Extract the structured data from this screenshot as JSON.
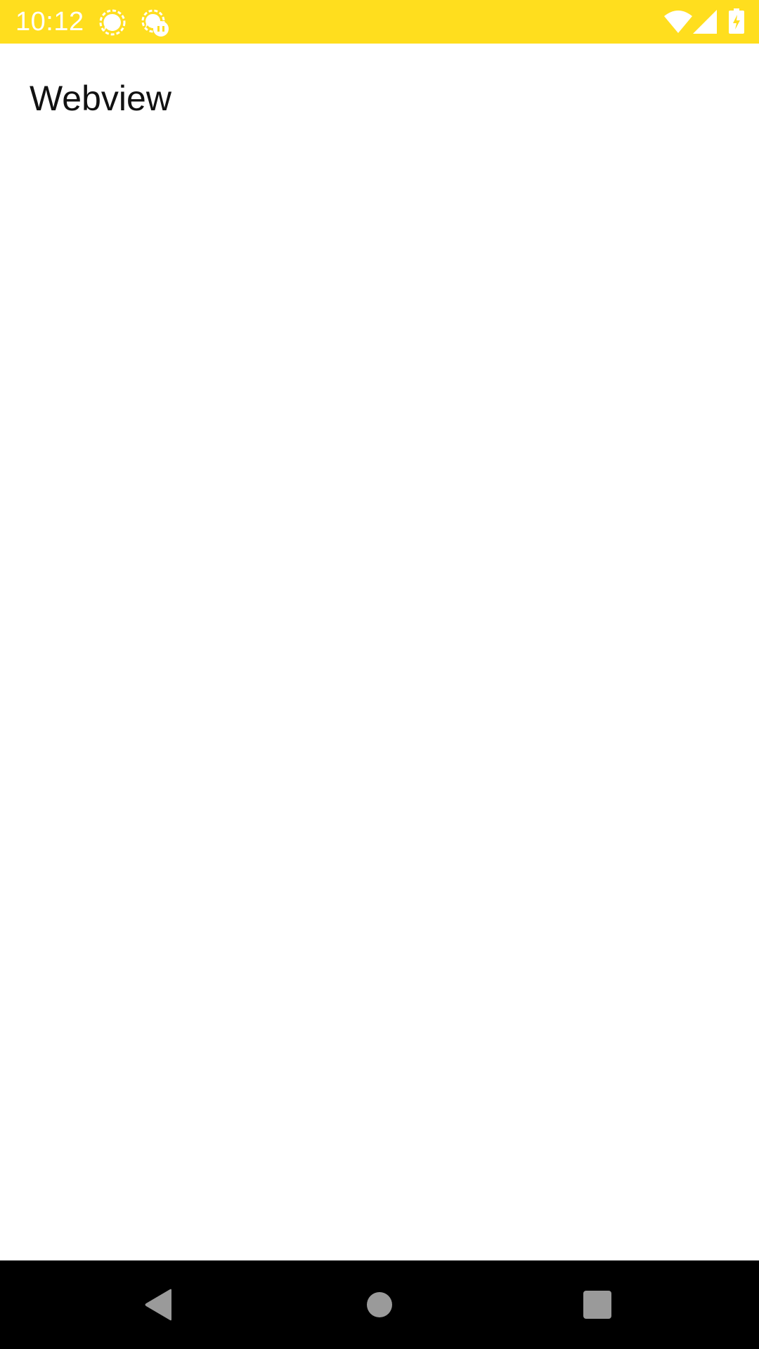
{
  "status_bar": {
    "time": "10:12",
    "background_color": "#FFDE1E",
    "icons": [
      "signal-messenger-icon",
      "signal-messenger-alert-icon",
      "wifi-icon",
      "cellular-signal-icon",
      "battery-charging-icon"
    ]
  },
  "page": {
    "title": "Webview"
  },
  "nav_bar": {
    "buttons": [
      "back-icon",
      "home-icon",
      "recents-icon"
    ],
    "icon_color": "#9a9a9a"
  }
}
